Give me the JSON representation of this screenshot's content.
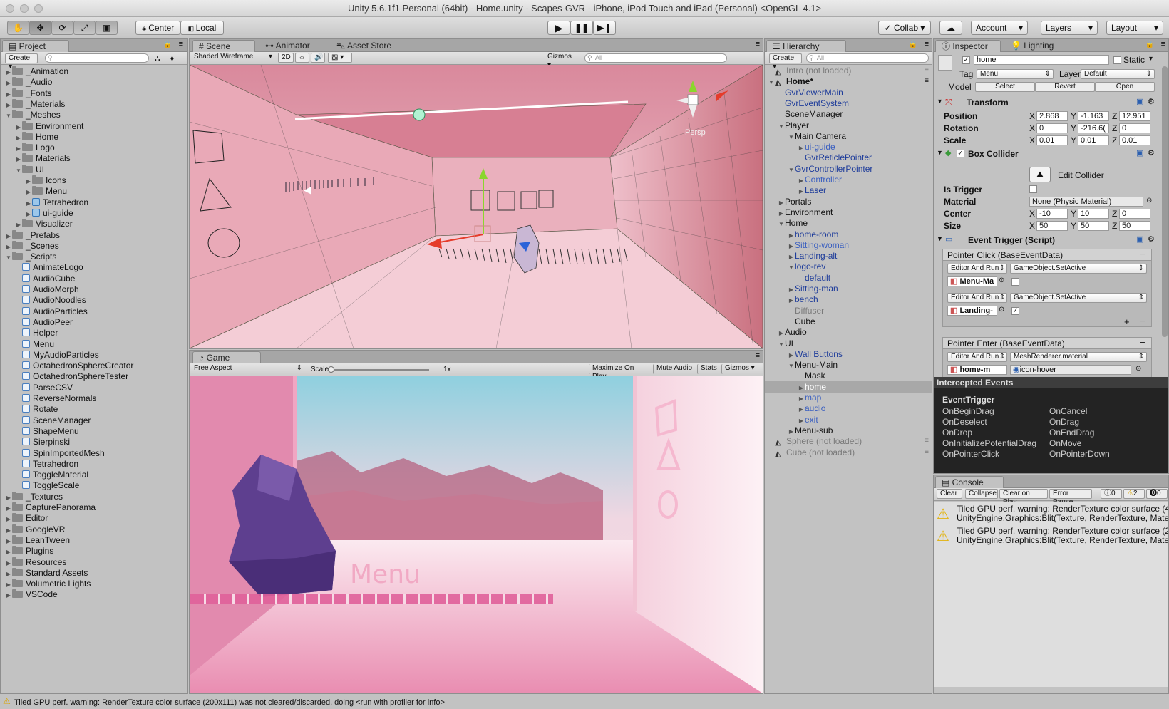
{
  "window": {
    "title": "Unity 5.6.1f1 Personal (64bit) - Home.unity - Scapes-GVR - iPhone, iPod Touch and iPad (Personal) <OpenGL 4.1>"
  },
  "toolbar": {
    "pivot": "Center",
    "space": "Local",
    "collab": "Collab",
    "account": "Account",
    "layers": "Layers",
    "layout": "Layout"
  },
  "project": {
    "tab": "Project",
    "create": "Create",
    "items": [
      {
        "label": "_Animation",
        "depth": 0,
        "arrow": "▶",
        "type": "folder"
      },
      {
        "label": "_Audio",
        "depth": 0,
        "arrow": "▶",
        "type": "folder"
      },
      {
        "label": "_Fonts",
        "depth": 0,
        "arrow": "▶",
        "type": "folder"
      },
      {
        "label": "_Materials",
        "depth": 0,
        "arrow": "▶",
        "type": "folder"
      },
      {
        "label": "_Meshes",
        "depth": 0,
        "arrow": "▼",
        "type": "folder"
      },
      {
        "label": "Environment",
        "depth": 1,
        "arrow": "▶",
        "type": "folder"
      },
      {
        "label": "Home",
        "depth": 1,
        "arrow": "▶",
        "type": "folder"
      },
      {
        "label": "Logo",
        "depth": 1,
        "arrow": "▶",
        "type": "folder"
      },
      {
        "label": "Materials",
        "depth": 1,
        "arrow": "▶",
        "type": "folder"
      },
      {
        "label": "UI",
        "depth": 1,
        "arrow": "▼",
        "type": "folder"
      },
      {
        "label": "Icons",
        "depth": 2,
        "arrow": "▶",
        "type": "folder"
      },
      {
        "label": "Menu",
        "depth": 2,
        "arrow": "▶",
        "type": "folder"
      },
      {
        "label": "Tetrahedron",
        "depth": 2,
        "arrow": "▶",
        "type": "mesh"
      },
      {
        "label": "ui-guide",
        "depth": 2,
        "arrow": "▶",
        "type": "mesh"
      },
      {
        "label": "Visualizer",
        "depth": 1,
        "arrow": "▶",
        "type": "folder"
      },
      {
        "label": "_Prefabs",
        "depth": 0,
        "arrow": "▶",
        "type": "folder"
      },
      {
        "label": "_Scenes",
        "depth": 0,
        "arrow": "▶",
        "type": "folder"
      },
      {
        "label": "_Scripts",
        "depth": 0,
        "arrow": "▼",
        "type": "folder"
      },
      {
        "label": "AnimateLogo",
        "depth": 1,
        "arrow": "",
        "type": "script"
      },
      {
        "label": "AudioCube",
        "depth": 1,
        "arrow": "",
        "type": "script"
      },
      {
        "label": "AudioMorph",
        "depth": 1,
        "arrow": "",
        "type": "script"
      },
      {
        "label": "AudioNoodles",
        "depth": 1,
        "arrow": "",
        "type": "script"
      },
      {
        "label": "AudioParticles",
        "depth": 1,
        "arrow": "",
        "type": "script"
      },
      {
        "label": "AudioPeer",
        "depth": 1,
        "arrow": "",
        "type": "script"
      },
      {
        "label": "Helper",
        "depth": 1,
        "arrow": "",
        "type": "script"
      },
      {
        "label": "Menu",
        "depth": 1,
        "arrow": "",
        "type": "script"
      },
      {
        "label": "MyAudioParticles",
        "depth": 1,
        "arrow": "",
        "type": "script"
      },
      {
        "label": "OctahedronSphereCreator",
        "depth": 1,
        "arrow": "",
        "type": "script"
      },
      {
        "label": "OctahedronSphereTester",
        "depth": 1,
        "arrow": "",
        "type": "script"
      },
      {
        "label": "ParseCSV",
        "depth": 1,
        "arrow": "",
        "type": "script"
      },
      {
        "label": "ReverseNormals",
        "depth": 1,
        "arrow": "",
        "type": "script"
      },
      {
        "label": "Rotate",
        "depth": 1,
        "arrow": "",
        "type": "script"
      },
      {
        "label": "SceneManager",
        "depth": 1,
        "arrow": "",
        "type": "script"
      },
      {
        "label": "ShapeMenu",
        "depth": 1,
        "arrow": "",
        "type": "script"
      },
      {
        "label": "Sierpinski",
        "depth": 1,
        "arrow": "",
        "type": "script"
      },
      {
        "label": "SpinImportedMesh",
        "depth": 1,
        "arrow": "",
        "type": "script"
      },
      {
        "label": "Tetrahedron",
        "depth": 1,
        "arrow": "",
        "type": "script"
      },
      {
        "label": "ToggleMaterial",
        "depth": 1,
        "arrow": "",
        "type": "script"
      },
      {
        "label": "ToggleScale",
        "depth": 1,
        "arrow": "",
        "type": "script"
      },
      {
        "label": "_Textures",
        "depth": 0,
        "arrow": "▶",
        "type": "folder"
      },
      {
        "label": "CapturePanorama",
        "depth": 0,
        "arrow": "▶",
        "type": "folder"
      },
      {
        "label": "Editor",
        "depth": 0,
        "arrow": "▶",
        "type": "folder"
      },
      {
        "label": "GoogleVR",
        "depth": 0,
        "arrow": "▶",
        "type": "folder"
      },
      {
        "label": "LeanTween",
        "depth": 0,
        "arrow": "▶",
        "type": "folder"
      },
      {
        "label": "Plugins",
        "depth": 0,
        "arrow": "▶",
        "type": "folder"
      },
      {
        "label": "Resources",
        "depth": 0,
        "arrow": "▶",
        "type": "folder"
      },
      {
        "label": "Standard Assets",
        "depth": 0,
        "arrow": "▶",
        "type": "folder"
      },
      {
        "label": "Volumetric Lights",
        "depth": 0,
        "arrow": "▶",
        "type": "folder"
      },
      {
        "label": "VSCode",
        "depth": 0,
        "arrow": "▶",
        "type": "folder"
      }
    ]
  },
  "scene": {
    "tabs": [
      "Scene",
      "Animator",
      "Asset Store"
    ],
    "shading": "Shaded Wireframe",
    "mode2d": "2D",
    "gizmos": "Gizmos",
    "search": "All",
    "persp": "Persp"
  },
  "game": {
    "tab": "Game",
    "aspect": "Free Aspect",
    "scale_label": "Scale",
    "scale_value": "1x",
    "maximize": "Maximize On Play",
    "mute": "Mute Audio",
    "stats": "Stats",
    "gizmos": "Gizmos",
    "menu_text": "Menu"
  },
  "hierarchy": {
    "tab": "Hierarchy",
    "create": "Create",
    "search": "All",
    "items": [
      {
        "label": "Intro (not loaded)",
        "depth": 0,
        "arrow": "",
        "style": "scene-gray"
      },
      {
        "label": "Home*",
        "depth": 0,
        "arrow": "▼",
        "style": "scene"
      },
      {
        "label": "GvrViewerMain",
        "depth": 1,
        "arrow": "",
        "style": "blue"
      },
      {
        "label": "GvrEventSystem",
        "depth": 1,
        "arrow": "",
        "style": "blue"
      },
      {
        "label": "SceneManager",
        "depth": 1,
        "arrow": "",
        "style": ""
      },
      {
        "label": "Player",
        "depth": 1,
        "arrow": "▼",
        "style": ""
      },
      {
        "label": "Main Camera",
        "depth": 2,
        "arrow": "▼",
        "style": ""
      },
      {
        "label": "ui-guide",
        "depth": 3,
        "arrow": "▶",
        "style": "blue2"
      },
      {
        "label": "GvrReticlePointer",
        "depth": 3,
        "arrow": "",
        "style": "blue"
      },
      {
        "label": "GvrControllerPointer",
        "depth": 2,
        "arrow": "▼",
        "style": "blue"
      },
      {
        "label": "Controller",
        "depth": 3,
        "arrow": "▶",
        "style": "blue2"
      },
      {
        "label": "Laser",
        "depth": 3,
        "arrow": "▶",
        "style": "blue"
      },
      {
        "label": "Portals",
        "depth": 1,
        "arrow": "▶",
        "style": ""
      },
      {
        "label": "Environment",
        "depth": 1,
        "arrow": "▶",
        "style": ""
      },
      {
        "label": "Home",
        "depth": 1,
        "arrow": "▼",
        "style": ""
      },
      {
        "label": "home-room",
        "depth": 2,
        "arrow": "▶",
        "style": "blue"
      },
      {
        "label": "Sitting-woman",
        "depth": 2,
        "arrow": "▶",
        "style": "blue2"
      },
      {
        "label": "Landing-alt",
        "depth": 2,
        "arrow": "▶",
        "style": "blue"
      },
      {
        "label": "logo-rev",
        "depth": 2,
        "arrow": "▼",
        "style": "blue"
      },
      {
        "label": "default",
        "depth": 3,
        "arrow": "",
        "style": "blue"
      },
      {
        "label": "Sitting-man",
        "depth": 2,
        "arrow": "▶",
        "style": "blue"
      },
      {
        "label": "bench",
        "depth": 2,
        "arrow": "▶",
        "style": "blue"
      },
      {
        "label": "Diffuser",
        "depth": 2,
        "arrow": "",
        "style": "gray"
      },
      {
        "label": "Cube",
        "depth": 2,
        "arrow": "",
        "style": ""
      },
      {
        "label": "Audio",
        "depth": 1,
        "arrow": "▶",
        "style": ""
      },
      {
        "label": "UI",
        "depth": 1,
        "arrow": "▼",
        "style": ""
      },
      {
        "label": "Wall Buttons",
        "depth": 2,
        "arrow": "▶",
        "style": "blue"
      },
      {
        "label": "Menu-Main",
        "depth": 2,
        "arrow": "▼",
        "style": ""
      },
      {
        "label": "Mask",
        "depth": 3,
        "arrow": "",
        "style": ""
      },
      {
        "label": "home",
        "depth": 3,
        "arrow": "▶",
        "style": "selected"
      },
      {
        "label": "map",
        "depth": 3,
        "arrow": "▶",
        "style": "blue2"
      },
      {
        "label": "audio",
        "depth": 3,
        "arrow": "▶",
        "style": "blue2"
      },
      {
        "label": "exit",
        "depth": 3,
        "arrow": "▶",
        "style": "blue2"
      },
      {
        "label": "Menu-sub",
        "depth": 2,
        "arrow": "▶",
        "style": ""
      },
      {
        "label": "Sphere (not loaded)",
        "depth": 0,
        "arrow": "",
        "style": "scene-gray"
      },
      {
        "label": "Cube (not loaded)",
        "depth": 0,
        "arrow": "",
        "style": "scene-gray"
      }
    ]
  },
  "inspector": {
    "tabs": [
      "Inspector",
      "Lighting"
    ],
    "object_name": "home",
    "static_label": "Static",
    "tag_label": "Tag",
    "tag_value": "Menu",
    "layer_label": "Layer",
    "layer_value": "Default",
    "model_label": "Model",
    "model_buttons": [
      "Select",
      "Revert",
      "Open"
    ],
    "transform": {
      "title": "Transform",
      "rows": [
        {
          "label": "Position",
          "x": "2.868",
          "y": "-1.163",
          "z": "12.951"
        },
        {
          "label": "Rotation",
          "x": "0",
          "y": "-216.6(",
          "z": "0"
        },
        {
          "label": "Scale",
          "x": "0.01",
          "y": "0.01",
          "z": "0.01"
        }
      ]
    },
    "box_collider": {
      "title": "Box Collider",
      "edit": "Edit Collider",
      "is_trigger": "Is Trigger",
      "material_label": "Material",
      "material_value": "None (Physic Material)",
      "center_label": "Center",
      "center": {
        "x": "-10",
        "y": "10",
        "z": "0"
      },
      "size_label": "Size",
      "size": {
        "x": "50",
        "y": "50",
        "z": "50"
      }
    },
    "event_trigger": {
      "title": "Event Trigger (Script)",
      "pointer_click": "Pointer Click (BaseEventData)",
      "pointer_enter": "Pointer Enter (BaseEventData)",
      "click_entries": [
        {
          "runtime": "Editor And Run",
          "func": "GameObject.SetActive",
          "target": "Menu-Ma",
          "checked": false
        },
        {
          "runtime": "Editor And Run",
          "func": "GameObject.SetActive",
          "target": "Landing-",
          "checked": true
        }
      ],
      "enter_entry": {
        "runtime": "Editor And Run",
        "func": "MeshRenderer.material",
        "target": "home-m",
        "value": "icon-hover"
      }
    },
    "intercepted": {
      "title": "Intercepted Events",
      "header": "EventTrigger",
      "left": [
        "OnBeginDrag",
        "OnDeselect",
        "OnDrop",
        "OnInitializePotentialDrag",
        "OnPointerClick"
      ],
      "right": [
        "OnCancel",
        "OnDrag",
        "OnEndDrag",
        "OnMove",
        "OnPointerDown"
      ]
    }
  },
  "console": {
    "tab": "Console",
    "buttons": [
      "Clear",
      "Collapse",
      "Clear on Play",
      "Error Pause"
    ],
    "counts": {
      "info": "0",
      "warn": "2",
      "error": "0"
    },
    "messages": [
      {
        "line1": "Tiled GPU perf. warning: RenderTexture color surface (4",
        "line2": "UnityEngine.Graphics:Blit(Texture, RenderTexture, Mate"
      },
      {
        "line1": "Tiled GPU perf. warning: RenderTexture color surface (2",
        "line2": "UnityEngine.Graphics:Blit(Texture, RenderTexture, Mate"
      }
    ]
  },
  "status": {
    "text": "Tiled GPU perf. warning: RenderTexture color surface (200x111) was not cleared/discarded, doing <run with profiler for info>"
  },
  "colors": {
    "accent_blue": "#1e3c9a",
    "selection": "#a8a8a8",
    "warn": "#f0c419",
    "scene_pink": "#e9a4b4"
  }
}
